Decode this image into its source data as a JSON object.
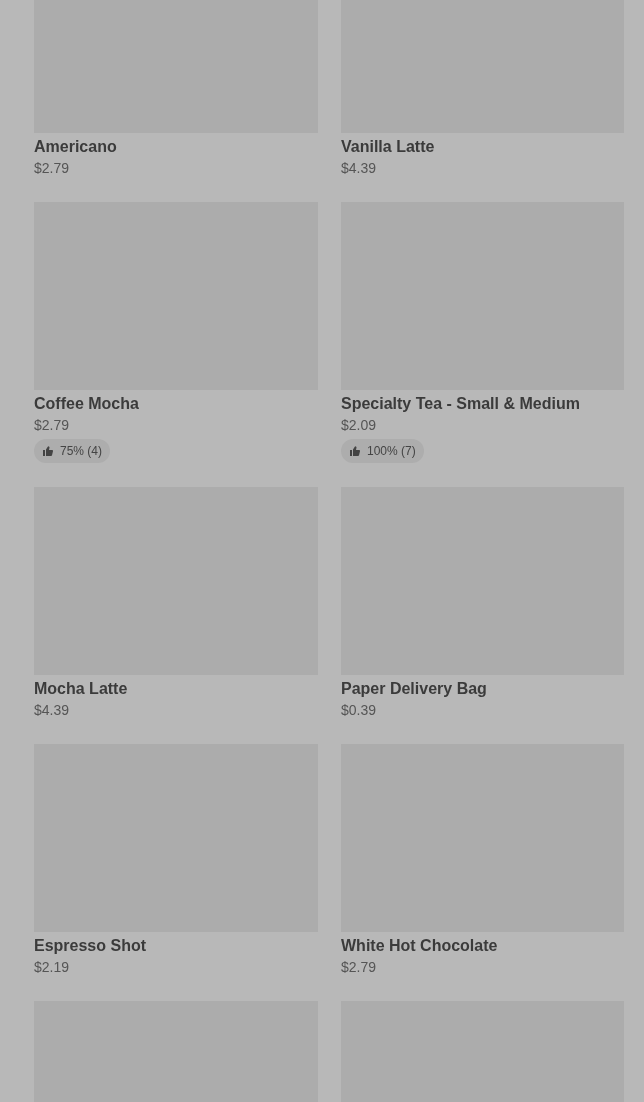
{
  "products": [
    {
      "kind": "product",
      "name": "Americano",
      "price": "$2.79"
    },
    {
      "kind": "product",
      "name": "Vanilla Latte",
      "price": "$4.39"
    },
    {
      "kind": "product",
      "name": "Coffee Mocha",
      "price": "$2.79",
      "rating": "75% (4)"
    },
    {
      "kind": "product",
      "name": "Specialty Tea - Small & Medium",
      "price": "$2.09",
      "rating": "100% (7)"
    },
    {
      "kind": "product",
      "name": "Mocha Latte",
      "price": "$4.39"
    },
    {
      "kind": "product",
      "name": "Paper Delivery Bag",
      "price": "$0.39"
    },
    {
      "kind": "product",
      "name": "Espresso Shot",
      "price": "$2.19"
    },
    {
      "kind": "product",
      "name": "White Hot Chocolate",
      "price": "$2.79"
    },
    {
      "kind": "picture-only"
    },
    {
      "kind": "picture-only"
    }
  ]
}
